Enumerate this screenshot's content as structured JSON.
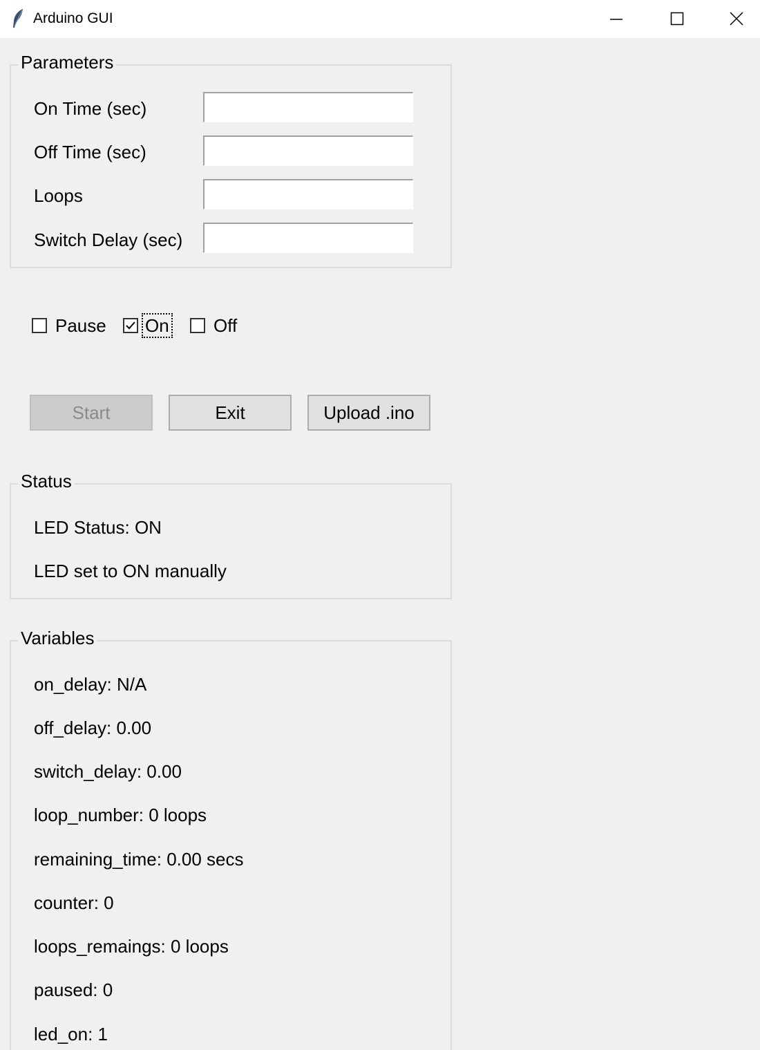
{
  "window": {
    "title": "Arduino GUI",
    "icon": "feather-icon",
    "controls": [
      "minimize-icon",
      "maximize-icon",
      "close-icon"
    ]
  },
  "parameters": {
    "title": "Parameters",
    "fields": [
      {
        "label": "On Time (sec)",
        "value": "",
        "placeholder": ""
      },
      {
        "label": "Off Time (sec)",
        "value": "",
        "placeholder": ""
      },
      {
        "label": "Loops",
        "value": "",
        "placeholder": ""
      },
      {
        "label": "Switch Delay (sec)",
        "value": "",
        "placeholder": ""
      }
    ]
  },
  "modes": [
    {
      "label": "Pause",
      "checked": false
    },
    {
      "label": "On",
      "checked": true
    },
    {
      "label": "Off",
      "checked": false
    }
  ],
  "buttons": {
    "start": "Start",
    "exit": "Exit",
    "upload": "Upload .ino"
  },
  "status": {
    "title": "Status",
    "led_status": "LED Status: ON",
    "message": "LED set to ON manually"
  },
  "variables": {
    "title": "Variables",
    "items": [
      "on_delay: N/A",
      "off_delay: 0.00",
      "switch_delay: 0.00",
      "loop_number: 0 loops",
      "remaining_time: 0.00 secs",
      "counter: 0",
      "loops_remaings: 0 loops",
      "paused: 0",
      "led_on: 1"
    ]
  }
}
